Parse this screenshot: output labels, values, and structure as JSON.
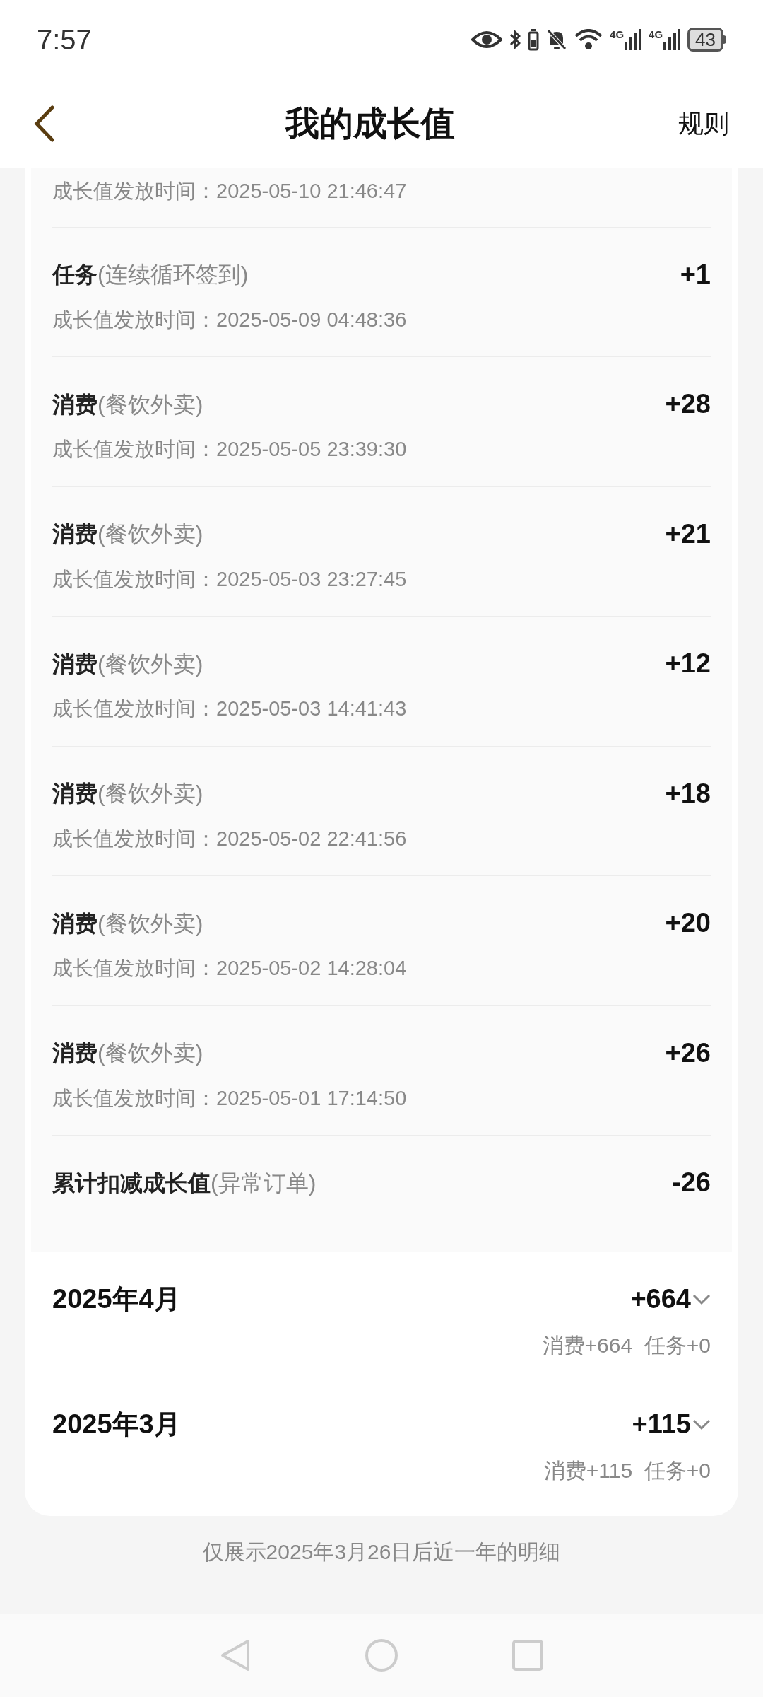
{
  "status_bar": {
    "time": "7:57",
    "networks": [
      "4G",
      "4G"
    ],
    "battery": "43"
  },
  "header": {
    "title": "我的成长值",
    "action": "规则"
  },
  "details": [
    {
      "time": "成长值发放时间：2025-05-10 21:46:47"
    },
    {
      "title": "任务",
      "detail": "(连续循环签到)",
      "points": "+1",
      "time": "成长值发放时间：2025-05-09 04:48:36"
    },
    {
      "title": "消费",
      "detail": "(餐饮外卖)",
      "points": "+28",
      "time": "成长值发放时间：2025-05-05 23:39:30"
    },
    {
      "title": "消费",
      "detail": "(餐饮外卖)",
      "points": "+21",
      "time": "成长值发放时间：2025-05-03 23:27:45"
    },
    {
      "title": "消费",
      "detail": "(餐饮外卖)",
      "points": "+12",
      "time": "成长值发放时间：2025-05-03 14:41:43"
    },
    {
      "title": "消费",
      "detail": "(餐饮外卖)",
      "points": "+18",
      "time": "成长值发放时间：2025-05-02 22:41:56"
    },
    {
      "title": "消费",
      "detail": "(餐饮外卖)",
      "points": "+20",
      "time": "成长值发放时间：2025-05-02 14:28:04"
    },
    {
      "title": "消费",
      "detail": "(餐饮外卖)",
      "points": "+26",
      "time": "成长值发放时间：2025-05-01 17:14:50"
    },
    {
      "title": "累计扣减成长值",
      "detail": "(异常订单)",
      "points": "-26"
    }
  ],
  "months": [
    {
      "label": "2025年4月",
      "total": "+664",
      "breakdown": "消费+664  任务+0",
      "expanded": false
    },
    {
      "label": "2025年3月",
      "total": "+115",
      "breakdown": "消费+115  任务+0",
      "expanded": false
    }
  ],
  "footnote": "仅展示2025年3月26日后近一年的明细"
}
